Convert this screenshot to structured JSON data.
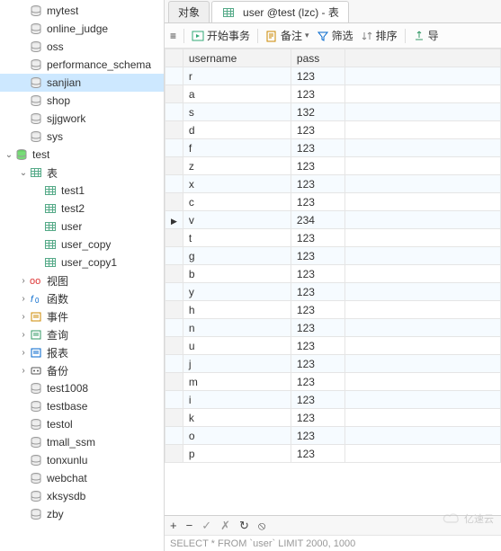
{
  "sidebar": {
    "databases_top": [
      {
        "label": "mytest"
      },
      {
        "label": "online_judge"
      },
      {
        "label": "oss"
      },
      {
        "label": "performance_schema"
      },
      {
        "label": "sanjian",
        "selected": true
      },
      {
        "label": "shop"
      },
      {
        "label": "sjjgwork"
      },
      {
        "label": "sys"
      }
    ],
    "test_label": "test",
    "table_group_label": "表",
    "tables": [
      {
        "label": "test1"
      },
      {
        "label": "test2"
      },
      {
        "label": "user"
      },
      {
        "label": "user_copy"
      },
      {
        "label": "user_copy1"
      }
    ],
    "subnodes": [
      {
        "label": "视图",
        "icon": "view"
      },
      {
        "label": "函数",
        "icon": "fx"
      },
      {
        "label": "事件",
        "icon": "event"
      },
      {
        "label": "查询",
        "icon": "query"
      },
      {
        "label": "报表",
        "icon": "report"
      },
      {
        "label": "备份",
        "icon": "backup"
      }
    ],
    "databases_bottom": [
      {
        "label": "test1008"
      },
      {
        "label": "testbase"
      },
      {
        "label": "testol"
      },
      {
        "label": "tmall_ssm"
      },
      {
        "label": "tonxunlu"
      },
      {
        "label": "webchat"
      },
      {
        "label": "xksysdb"
      },
      {
        "label": "zby"
      }
    ]
  },
  "tabs": [
    {
      "label": "对象",
      "active": false
    },
    {
      "label": "user @test (lzc) - 表",
      "active": true
    }
  ],
  "toolbar": {
    "menu": "≡",
    "start": "开始事务",
    "note": "备注",
    "note_caret": "▾",
    "filter": "筛选",
    "sort": "排序",
    "export": "导"
  },
  "grid": {
    "columns": [
      "username",
      "pass"
    ],
    "pointer_row": 8,
    "rows": [
      {
        "username": "r",
        "pass": "123"
      },
      {
        "username": "a",
        "pass": "123"
      },
      {
        "username": "s",
        "pass": "132"
      },
      {
        "username": "d",
        "pass": "123"
      },
      {
        "username": "f",
        "pass": "123"
      },
      {
        "username": "z",
        "pass": "123"
      },
      {
        "username": "x",
        "pass": "123"
      },
      {
        "username": "c",
        "pass": "123"
      },
      {
        "username": "v",
        "pass": "234"
      },
      {
        "username": "t",
        "pass": "123"
      },
      {
        "username": "g",
        "pass": "123"
      },
      {
        "username": "b",
        "pass": "123"
      },
      {
        "username": "y",
        "pass": "123"
      },
      {
        "username": "h",
        "pass": "123"
      },
      {
        "username": "n",
        "pass": "123"
      },
      {
        "username": "u",
        "pass": "123"
      },
      {
        "username": "j",
        "pass": "123"
      },
      {
        "username": "m",
        "pass": "123"
      },
      {
        "username": "i",
        "pass": "123"
      },
      {
        "username": "k",
        "pass": "123"
      },
      {
        "username": "o",
        "pass": "123"
      },
      {
        "username": "p",
        "pass": "123"
      }
    ]
  },
  "footbar": {
    "add": "+",
    "del": "−",
    "ok": "✓",
    "cancel": "✗",
    "refresh": "↻",
    "stop": "⦸"
  },
  "status": "SELECT * FROM `user` LIMIT 2000, 1000",
  "watermark": "亿速云"
}
